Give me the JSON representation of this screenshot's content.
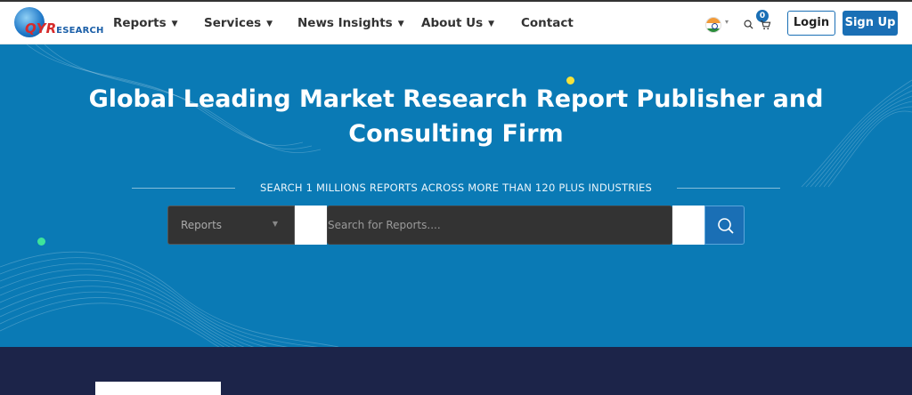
{
  "brand": {
    "logo_text_primary": "QYR",
    "logo_text_secondary": "ESEARCH"
  },
  "nav": {
    "items": [
      {
        "label": "Reports",
        "caret": "▼"
      },
      {
        "label": "Services",
        "caret": "▼"
      },
      {
        "label": "News Insights",
        "caret": "▼"
      },
      {
        "label": "About Us",
        "caret": "▼"
      },
      {
        "label": "Contact",
        "caret": ""
      }
    ],
    "cart_count": "0",
    "login_label": "Login",
    "signup_label": "Sign Up",
    "language_icon": "india-flag-icon"
  },
  "hero": {
    "title": "Global Leading Market Research Report Publisher and Consulting Firm",
    "tagline": "SEARCH 1 MILLIONS REPORTS ACROSS MORE THAN 120 PLUS INDUSTRIES"
  },
  "search": {
    "category_selected": "Reports",
    "placeholder": "Search for Reports....",
    "button_icon": "search-icon"
  },
  "colors": {
    "hero_bg": "#0a7ab5",
    "primary": "#1a6fb5",
    "footer_bg": "#1c2449",
    "logo_red": "#d62b2b"
  }
}
